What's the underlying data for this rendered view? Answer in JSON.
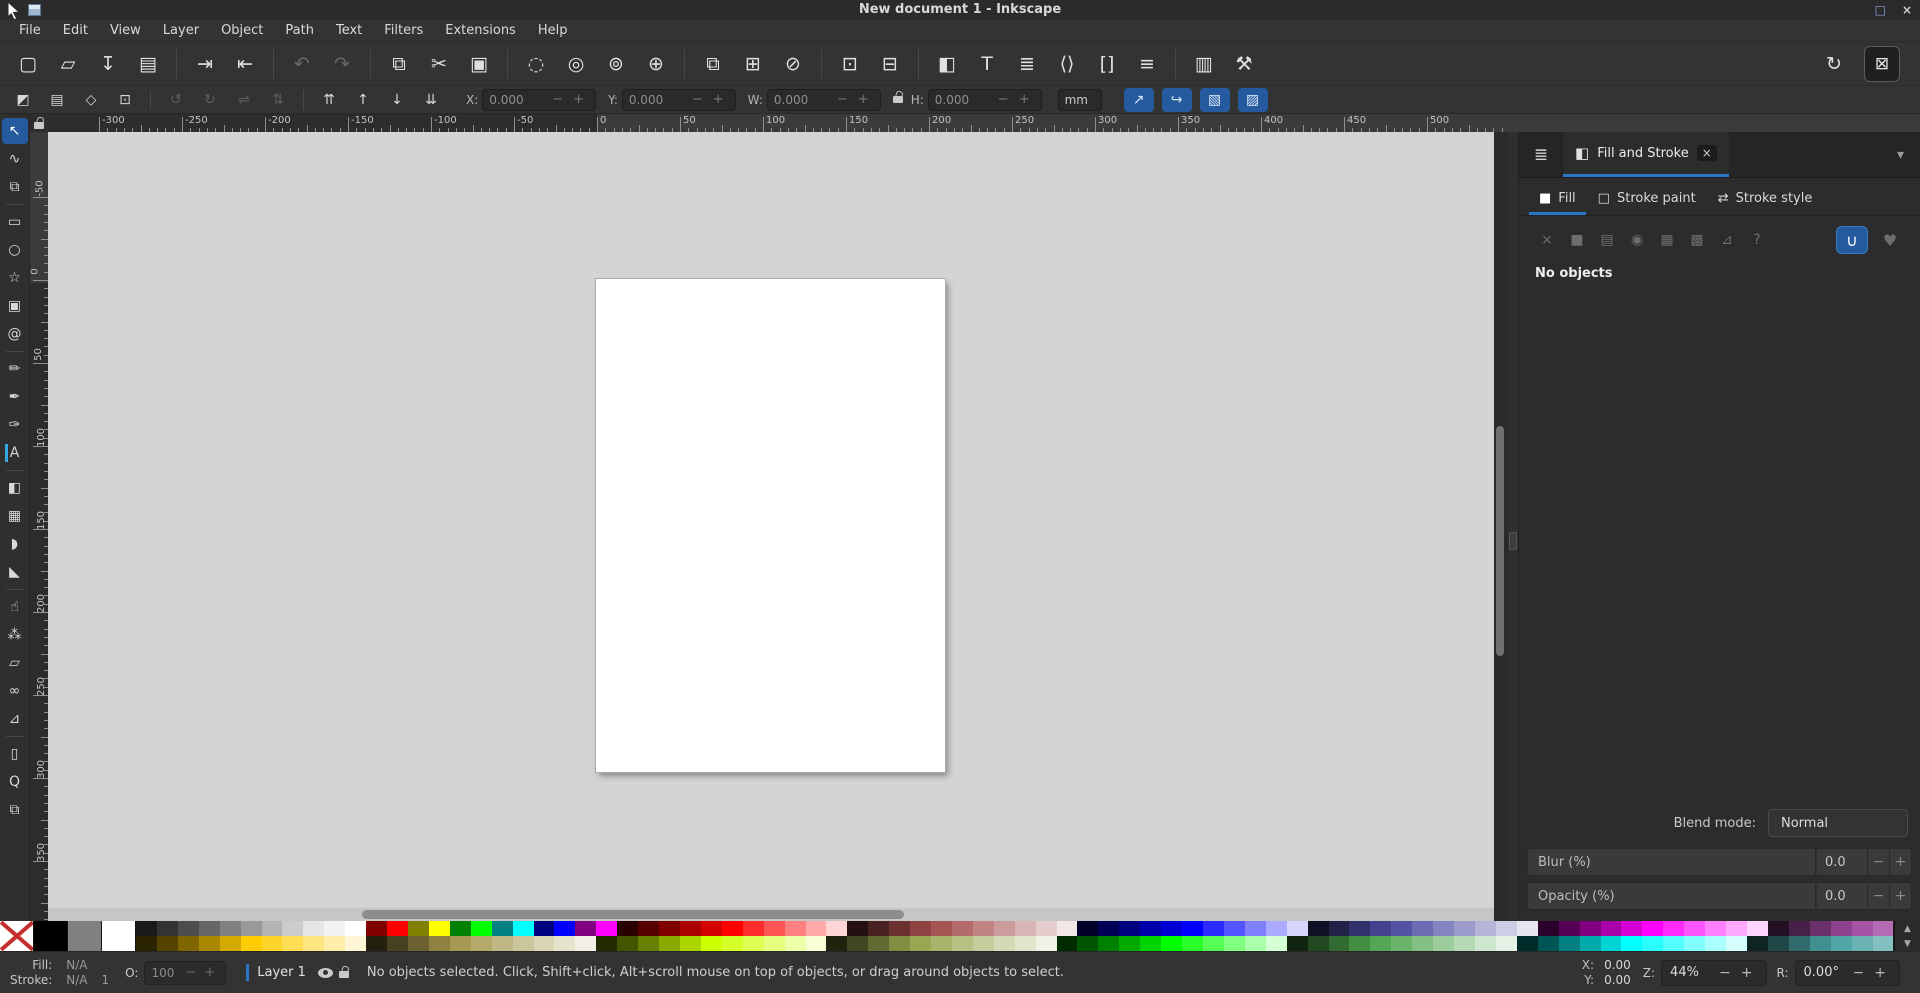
{
  "window": {
    "title": "New document 1 - Inkscape",
    "maximize_glyph": "□",
    "close_glyph": "×"
  },
  "menubar": {
    "items": [
      "File",
      "Edit",
      "View",
      "Layer",
      "Object",
      "Path",
      "Text",
      "Filters",
      "Extensions",
      "Help"
    ]
  },
  "commandbar": {
    "items": [
      {
        "name": "new-document",
        "glyph": "▢"
      },
      {
        "name": "open-document",
        "glyph": "▱"
      },
      {
        "name": "save-document",
        "glyph": "↧"
      },
      {
        "name": "print-document",
        "glyph": "▤"
      },
      {
        "sep": true
      },
      {
        "name": "import-image",
        "glyph": "⇥"
      },
      {
        "name": "export-image",
        "glyph": "⇤"
      },
      {
        "sep": true
      },
      {
        "name": "undo",
        "glyph": "↶",
        "disabled": true
      },
      {
        "name": "redo",
        "glyph": "↷",
        "disabled": true
      },
      {
        "sep": true
      },
      {
        "name": "copy",
        "glyph": "⧉"
      },
      {
        "name": "cut",
        "glyph": "✂"
      },
      {
        "name": "paste",
        "glyph": "▣"
      },
      {
        "sep": true
      },
      {
        "name": "zoom-selection",
        "glyph": "◌"
      },
      {
        "name": "zoom-drawing",
        "glyph": "◎"
      },
      {
        "name": "zoom-page",
        "glyph": "⊚"
      },
      {
        "name": "zoom-page-width",
        "glyph": "⊕"
      },
      {
        "sep": true
      },
      {
        "name": "duplicate",
        "glyph": "⧉"
      },
      {
        "name": "create-clone",
        "glyph": "⊞"
      },
      {
        "name": "unlink-clone",
        "glyph": "⊘"
      },
      {
        "sep": true
      },
      {
        "name": "group",
        "glyph": "⊡"
      },
      {
        "name": "ungroup",
        "glyph": "⊟"
      },
      {
        "sep": true
      },
      {
        "name": "fill-stroke-dialog",
        "glyph": "◧"
      },
      {
        "name": "text-dialog",
        "glyph": "T"
      },
      {
        "name": "layers-dialog",
        "glyph": "≣"
      },
      {
        "name": "xml-editor",
        "glyph": "⟨⟩"
      },
      {
        "name": "objects-dialog",
        "glyph": "[]"
      },
      {
        "name": "align-distribute-dialog",
        "glyph": "≡"
      },
      {
        "sep": true
      },
      {
        "name": "document-properties",
        "glyph": "▥"
      },
      {
        "name": "preferences",
        "glyph": "⚒"
      }
    ],
    "snap_options_glyph": "↻",
    "snap_toggle_glyph": "⊠"
  },
  "tooloptions": {
    "select_group": [
      {
        "name": "select-all",
        "glyph": "◩"
      },
      {
        "name": "select-all-layers",
        "glyph": "▤"
      },
      {
        "name": "deselect",
        "glyph": "◇"
      },
      {
        "name": "select-same",
        "glyph": "⊡"
      }
    ],
    "transform_group": [
      {
        "name": "rotate-ccw",
        "glyph": "↺",
        "disabled": true
      },
      {
        "name": "rotate-cw",
        "glyph": "↻",
        "disabled": true
      },
      {
        "name": "flip-horizontal",
        "glyph": "⇌",
        "disabled": true
      },
      {
        "name": "flip-vertical",
        "glyph": "⇅",
        "disabled": true
      }
    ],
    "zorder_group": [
      {
        "name": "raise-to-top",
        "glyph": "⇈"
      },
      {
        "name": "raise",
        "glyph": "↑"
      },
      {
        "name": "lower",
        "glyph": "↓"
      },
      {
        "name": "lower-to-bottom",
        "glyph": "⇊"
      }
    ],
    "x_label": "X:",
    "x_value": "0.000",
    "y_label": "Y:",
    "y_value": "0.000",
    "w_label": "W:",
    "w_value": "0.000",
    "h_label": "H:",
    "h_value": "0.000",
    "unit_value": "mm",
    "minus_glyph": "−",
    "plus_glyph": "+",
    "toggles": [
      {
        "name": "scale-stroke-toggle",
        "glyph": "↗"
      },
      {
        "name": "scale-radii-toggle",
        "glyph": "↪"
      },
      {
        "name": "move-gradients-toggle",
        "glyph": "▧"
      },
      {
        "name": "move-patterns-toggle",
        "glyph": "▨"
      }
    ]
  },
  "toolbox": {
    "tools": [
      {
        "name": "selector-tool",
        "glyph": "↖",
        "active": true
      },
      {
        "name": "node-tool",
        "glyph": "∿"
      },
      {
        "name": "shape-builder-tool",
        "glyph": "⧉",
        "sep_after": true
      },
      {
        "name": "rectangle-tool",
        "glyph": "▭"
      },
      {
        "name": "ellipse-tool",
        "glyph": "○"
      },
      {
        "name": "star-tool",
        "glyph": "☆"
      },
      {
        "name": "box-3d-tool",
        "glyph": "▣"
      },
      {
        "name": "spiral-tool",
        "glyph": "@",
        "sep_after": true
      },
      {
        "name": "pencil-tool",
        "glyph": "✏"
      },
      {
        "name": "pen-tool",
        "glyph": "✒"
      },
      {
        "name": "calligraphy-tool",
        "glyph": "✑"
      },
      {
        "name": "text-tool",
        "glyph": "A",
        "caret": true,
        "sep_after": true
      },
      {
        "name": "gradient-tool",
        "glyph": "◧"
      },
      {
        "name": "mesh-tool",
        "glyph": "▦"
      },
      {
        "name": "dropper-tool",
        "glyph": "◗"
      },
      {
        "name": "paint-bucket-tool",
        "glyph": "◣",
        "sep_after": true
      },
      {
        "name": "tweak-tool",
        "glyph": "☝"
      },
      {
        "name": "spray-tool",
        "glyph": "⁂"
      },
      {
        "name": "eraser-tool",
        "glyph": "▱"
      },
      {
        "name": "connector-tool",
        "glyph": "∞"
      },
      {
        "name": "measure-tool",
        "glyph": "⊿",
        "sep_after": true
      },
      {
        "name": "page-tool",
        "glyph": "▯"
      },
      {
        "name": "zoom-tool",
        "glyph": "Q"
      },
      {
        "name": "pages-tool",
        "glyph": "⧉"
      }
    ]
  },
  "rulers": {
    "h_labels": [
      "-300",
      "-250",
      "-200",
      "-150",
      "-100",
      "-50",
      "0",
      "50",
      "100",
      "150",
      "200",
      "250",
      "300",
      "350",
      "400",
      "450",
      "500"
    ],
    "v_labels": [
      "-50",
      "0",
      "50",
      "100",
      "150",
      "200",
      "250",
      "300",
      "350"
    ]
  },
  "dock": {
    "layers_button_glyph": "≣",
    "tab_icon_glyph": "◧",
    "tab_title": "Fill and Stroke",
    "tab_close_glyph": "×",
    "chevron_glyph": "▾",
    "tabs": [
      {
        "name": "tab-fill",
        "label": "Fill",
        "icon": "■",
        "active": true
      },
      {
        "name": "tab-stroke-paint",
        "label": "Stroke paint",
        "icon": "□"
      },
      {
        "name": "tab-stroke-style",
        "label": "Stroke style",
        "icon": "⇄"
      }
    ],
    "paint_types": [
      {
        "name": "paint-none",
        "glyph": "×"
      },
      {
        "name": "paint-flat-color",
        "glyph": "■"
      },
      {
        "name": "paint-linear-gradient",
        "glyph": "▤"
      },
      {
        "name": "paint-radial-gradient",
        "glyph": "◉"
      },
      {
        "name": "paint-pattern",
        "glyph": "▦"
      },
      {
        "name": "paint-swatch",
        "glyph": "▩"
      },
      {
        "name": "paint-mesh",
        "glyph": "⊿"
      },
      {
        "name": "paint-unknown",
        "glyph": "?"
      }
    ],
    "fill_rules": [
      {
        "name": "fill-rule-even-odd",
        "glyph": "∪",
        "active": true
      },
      {
        "name": "fill-rule-nonzero",
        "glyph": "♥"
      }
    ],
    "no_objects_text": "No objects",
    "blend_label": "Blend mode:",
    "blend_value": "Normal",
    "blur_label": "Blur (%)",
    "blur_value": "0.0",
    "opacity_label": "Opacity (%)",
    "opacity_value": "0.0",
    "minus_glyph": "−",
    "plus_glyph": "+"
  },
  "palette": {
    "large": [
      "none",
      "#000000",
      "#808080",
      "#ffffff"
    ],
    "row1": [
      "#1a1a1a",
      "#333333",
      "#4d4d4d",
      "#666666",
      "#808080",
      "#999999",
      "#b3b3b3",
      "#cccccc",
      "#e6e6e6",
      "#f2f2f2",
      "#ffffff",
      "#800000",
      "#ff0000",
      "#808000",
      "#ffff00",
      "#008000",
      "#00ff00",
      "#008080",
      "#00ffff",
      "#000080",
      "#0000ff",
      "#800080",
      "#ff00ff",
      "#2b0000",
      "#550000",
      "#800000",
      "#aa0000",
      "#d40000",
      "#ff0000",
      "#ff2a2a",
      "#ff5555",
      "#ff8080",
      "#ffaaaa",
      "#ffd5d5",
      "#241010",
      "#482121",
      "#6b3131",
      "#8f4242",
      "#a65353",
      "#b36b6b",
      "#c08484",
      "#cc9c9c",
      "#d9b5b5",
      "#e6cdcd",
      "#f2e6e6",
      "#00002b",
      "#000055",
      "#000080",
      "#0000aa",
      "#0000d4",
      "#0000ff",
      "#2a2aff",
      "#5555ff",
      "#8080ff",
      "#aaaaff",
      "#d5d5ff",
      "#101024",
      "#212148",
      "#31316b",
      "#42428f",
      "#5353a6",
      "#6b6bb3",
      "#8484c0",
      "#9c9ccc",
      "#b5b5d9",
      "#cdcde6",
      "#e6e6f2",
      "#2b002b",
      "#550055",
      "#800080",
      "#aa00aa",
      "#d400d4",
      "#ff00ff",
      "#ff2aff",
      "#ff55ff",
      "#ff80ff",
      "#ffaaff",
      "#ffd5ff",
      "#241024",
      "#482148",
      "#6b316b",
      "#8f428f",
      "#a653a6",
      "#b36bb3"
    ],
    "row2": [
      "#2b2200",
      "#554400",
      "#806600",
      "#aa8800",
      "#d4aa00",
      "#ffcc00",
      "#ffd42a",
      "#ffdd55",
      "#ffe680",
      "#ffeeaa",
      "#fff6d5",
      "#242010",
      "#484121",
      "#6b6131",
      "#8f8142",
      "#a69953",
      "#b3a96b",
      "#c0b884",
      "#ccc69c",
      "#d9d5b5",
      "#e6e3cd",
      "#f2f0e6",
      "#222b00",
      "#445500",
      "#668000",
      "#88aa00",
      "#aad400",
      "#ccff00",
      "#d4ff2a",
      "#ddff55",
      "#e6ff80",
      "#eeffaa",
      "#f6ffd5",
      "#20240f",
      "#414821",
      "#616b31",
      "#818f42",
      "#99a653",
      "#a9b36b",
      "#b8c084",
      "#c6cc9c",
      "#d5d9b5",
      "#e3e6cd",
      "#f0f2e6",
      "#002b00",
      "#005500",
      "#008000",
      "#00aa00",
      "#00d400",
      "#00ff00",
      "#2aff2a",
      "#55ff55",
      "#80ff80",
      "#aaffaa",
      "#d5ffd5",
      "#102410",
      "#214821",
      "#316b31",
      "#428f42",
      "#53a653",
      "#6bb36b",
      "#84c084",
      "#9ccc9c",
      "#b5d9b5",
      "#cde6cd",
      "#e6f2e6",
      "#002b2b",
      "#005555",
      "#008080",
      "#00aaaa",
      "#00d4d4",
      "#00ffff",
      "#2affff",
      "#55ffff",
      "#80ffff",
      "#aaffff",
      "#d5ffff",
      "#102424",
      "#214848",
      "#316b6b",
      "#428f8f",
      "#53a6a6",
      "#6bb3b3",
      "#84c0c0"
    ],
    "scroll_up_glyph": "▲",
    "scroll_down_glyph": "▼"
  },
  "statusbar": {
    "fill_label": "Fill:",
    "fill_value": "N/A",
    "stroke_label": "Stroke:",
    "stroke_value": "N/A",
    "stroke_width": "1",
    "opacity_label": "O:",
    "opacity_value": "100",
    "layer_name": "Layer 1",
    "message": "No objects selected. Click, Shift+click, Alt+scroll mouse on top of objects, or drag around objects to select.",
    "x_label": "X:",
    "x_value": "0.00",
    "y_label": "Y:",
    "y_value": "0.00",
    "zoom_label": "Z:",
    "zoom_value": "44%",
    "rotation_label": "R:",
    "rotation_value": "0.00°",
    "minus_glyph": "−",
    "plus_glyph": "+"
  },
  "colors": {
    "accent_blue": "#2a76c8",
    "toggle_blue": "#255b9e",
    "canvas_gray": "#d4d4d4",
    "panel_dark": "#2c2c2c"
  }
}
